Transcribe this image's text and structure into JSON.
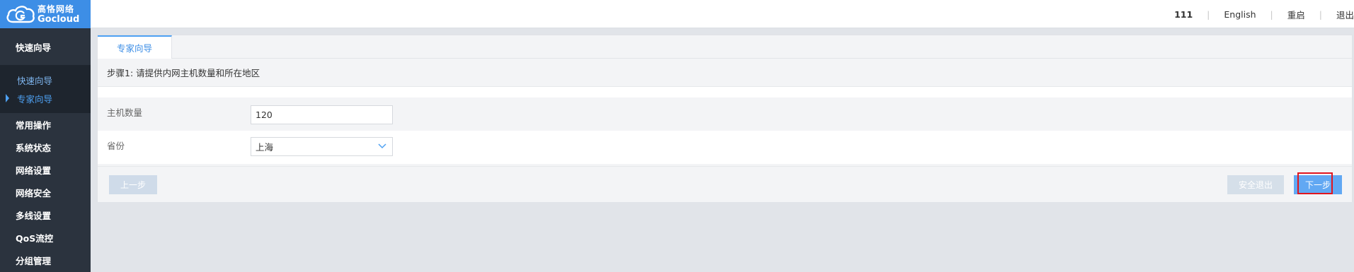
{
  "brand": {
    "name_cn": "高恪网络",
    "name_en": "Gocloud"
  },
  "sidebar": {
    "group_title": "快速向导",
    "sub_items": [
      {
        "label": "快速向导",
        "active": false
      },
      {
        "label": "专家向导",
        "active": true
      }
    ],
    "items": [
      {
        "label": "常用操作"
      },
      {
        "label": "系统状态"
      },
      {
        "label": "网络设置"
      },
      {
        "label": "网络安全"
      },
      {
        "label": "多线设置"
      },
      {
        "label": "QoS流控"
      },
      {
        "label": "分组管理"
      }
    ]
  },
  "topbar": {
    "user": "111",
    "language": "English",
    "restart": "重启",
    "logout": "退出"
  },
  "panel": {
    "tab_label": "专家向导",
    "step_text": "步骤1: 请提供内网主机数量和所在地区",
    "fields": {
      "host_count_label": "主机数量",
      "host_count_value": "120",
      "province_label": "省份",
      "province_value": "上海"
    },
    "buttons": {
      "prev": "上一步",
      "exit": "安全退出",
      "next": "下一步"
    }
  },
  "colors": {
    "brand_blue": "#3d8ee6",
    "sidebar_bg": "#2b333e",
    "accent": "#4ea1f3",
    "highlight_red": "#e0151f"
  }
}
